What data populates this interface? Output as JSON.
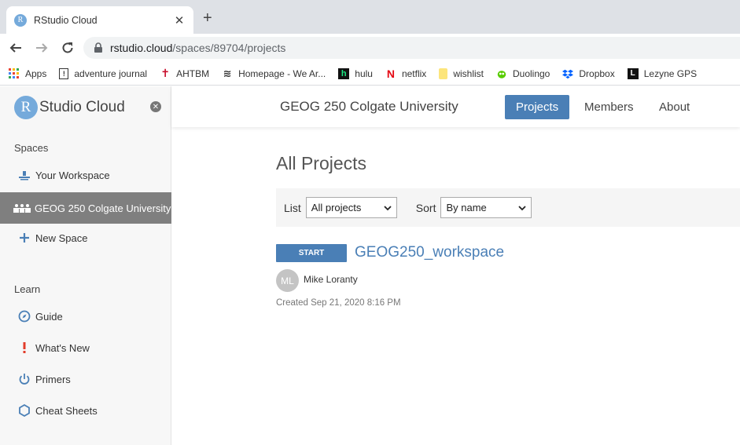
{
  "browser": {
    "tab_title": "RStudio Cloud",
    "tab_favicon": "R",
    "close_glyph": "✕",
    "new_tab_glyph": "+",
    "url_host": "rstudio.cloud",
    "url_path": "/spaces/89704/projects"
  },
  "bookmarks": [
    {
      "label": "Apps",
      "icon": "apps-grid-icon"
    },
    {
      "label": "adventure journal",
      "icon": "bookmark-icon"
    },
    {
      "label": "AHTBM",
      "icon": "cross-icon"
    },
    {
      "label": "Homepage - We Ar...",
      "icon": "wave-icon"
    },
    {
      "label": "hulu",
      "icon": "hulu-icon"
    },
    {
      "label": "netflix",
      "icon": "netflix-icon"
    },
    {
      "label": "wishlist",
      "icon": "note-icon"
    },
    {
      "label": "Duolingo",
      "icon": "owl-icon"
    },
    {
      "label": "Dropbox",
      "icon": "dropbox-icon"
    },
    {
      "label": "Lezyne GPS",
      "icon": "lezyne-icon"
    }
  ],
  "sidebar": {
    "brand_logo": "R",
    "brand_name": "Studio Cloud",
    "close_glyph": "✕",
    "spaces_label": "Spaces",
    "spaces": [
      {
        "label": "Your Workspace",
        "active": false
      },
      {
        "label": "GEOG 250 Colgate University",
        "active": true
      },
      {
        "label": "New Space",
        "active": false
      }
    ],
    "learn_label": "Learn",
    "learn": [
      {
        "label": "Guide"
      },
      {
        "label": "What's New"
      },
      {
        "label": "Primers"
      },
      {
        "label": "Cheat Sheets"
      }
    ]
  },
  "header": {
    "space_title": "GEOG 250 Colgate University",
    "nav": [
      {
        "label": "Projects",
        "active": true
      },
      {
        "label": "Members",
        "active": false
      },
      {
        "label": "About",
        "active": false
      }
    ]
  },
  "main": {
    "title": "All Projects",
    "filter_list_label": "List",
    "filter_list_value": "All projects",
    "sort_label": "Sort",
    "sort_value": "By name",
    "project": {
      "start_label": "START",
      "name": "GEOG250_workspace",
      "owner_initials": "ML",
      "owner": "Mike Loranty",
      "created": "Created Sep 21, 2020 8:16 PM"
    }
  },
  "colors": {
    "accent": "#4a7fb6",
    "logo": "#75aadb",
    "active_sidebar": "#7f7f7f"
  }
}
